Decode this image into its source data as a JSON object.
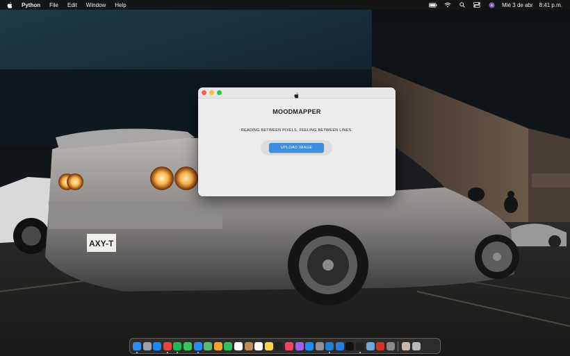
{
  "menubar": {
    "app_name": "Python",
    "menus": [
      "File",
      "Edit",
      "Window",
      "Help"
    ],
    "date": "Mié 3 de abr",
    "time": "8:41 p.m.",
    "status_icons": [
      "battery-icon",
      "wifi-icon",
      "spotlight-search-icon",
      "control-center-icon",
      "siri-icon"
    ]
  },
  "window": {
    "title": "MOODMAPPER",
    "subtitle": "READING BETWEEN PIXELS, FEELING BETWEEN LINES.",
    "upload_label": "UPLOAD IMAGE",
    "accent_color": "#3b8ee0"
  },
  "dock": {
    "apps": [
      {
        "name": "finder",
        "color": "#2f8ff0"
      },
      {
        "name": "launchpad",
        "color": "#9aa0ad"
      },
      {
        "name": "safari",
        "color": "#1f86f0"
      },
      {
        "name": "chrome",
        "color": "#e7463a"
      },
      {
        "name": "spotify",
        "color": "#1db954"
      },
      {
        "name": "messages",
        "color": "#34c759"
      },
      {
        "name": "mail",
        "color": "#2a8cf0"
      },
      {
        "name": "maps",
        "color": "#5bb974"
      },
      {
        "name": "photos",
        "color": "#f4a22d"
      },
      {
        "name": "facetime",
        "color": "#2fc15a"
      },
      {
        "name": "calendar",
        "color": "#ffffff"
      },
      {
        "name": "contacts",
        "color": "#c08a53"
      },
      {
        "name": "reminders",
        "color": "#f5f5f5"
      },
      {
        "name": "notes",
        "color": "#f8d34a"
      },
      {
        "name": "tv",
        "color": "#222222"
      },
      {
        "name": "music",
        "color": "#f8425c"
      },
      {
        "name": "podcasts",
        "color": "#a35cf0"
      },
      {
        "name": "app-store",
        "color": "#1e8df0"
      },
      {
        "name": "system-settings",
        "color": "#8e8e93"
      },
      {
        "name": "vscode",
        "color": "#1f7fd0"
      },
      {
        "name": "xcode",
        "color": "#2a7de0"
      },
      {
        "name": "capcut",
        "color": "#111111"
      },
      {
        "name": "terminal",
        "color": "#222222"
      },
      {
        "name": "preview",
        "color": "#6fa6d8"
      },
      {
        "name": "acrobat",
        "color": "#d8322c"
      },
      {
        "name": "dictionary",
        "color": "#8a8a8a"
      }
    ],
    "right_items": [
      {
        "name": "recent-window",
        "color": "#c7b9a8"
      },
      {
        "name": "trash",
        "color": "#b8b8b8"
      }
    ]
  }
}
